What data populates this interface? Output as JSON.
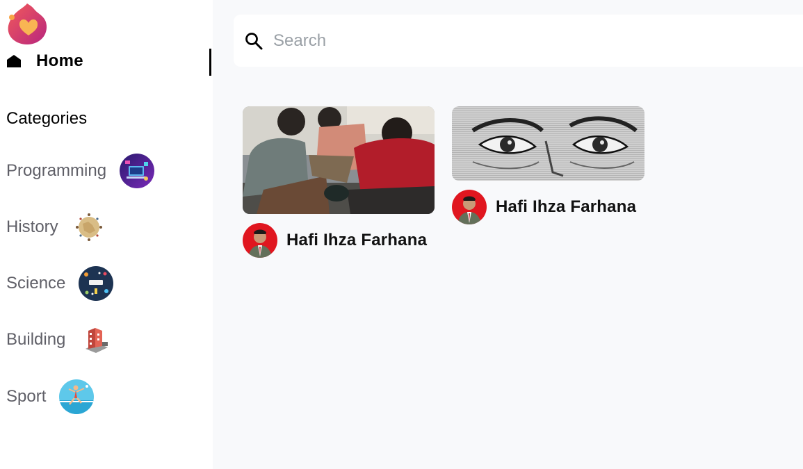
{
  "sidebar": {
    "home_label": "Home",
    "categories_heading": "Categories",
    "categories": [
      {
        "label": "Programming",
        "icon": "programming-thumbnail"
      },
      {
        "label": "History",
        "icon": "history-thumbnail"
      },
      {
        "label": "Science",
        "icon": "science-thumbnail"
      },
      {
        "label": "Building",
        "icon": "building-thumbnail"
      },
      {
        "label": "Sport",
        "icon": "sport-thumbnail"
      }
    ]
  },
  "search": {
    "placeholder": "Search",
    "value": ""
  },
  "cards": [
    {
      "image": "people-gathered-photo",
      "author": "Hafi Ihza Farhana"
    },
    {
      "image": "engraved-eyes-photo",
      "author": "Hafi Ihza Farhana"
    }
  ],
  "colors": {
    "background": "#f8f9fb",
    "surface": "#ffffff",
    "category_text": "#5f5f67",
    "placeholder": "#9aa0a6",
    "logo_gradient": [
      "#f04e64",
      "#c2307a"
    ],
    "logo_heart": "#f8b048"
  }
}
